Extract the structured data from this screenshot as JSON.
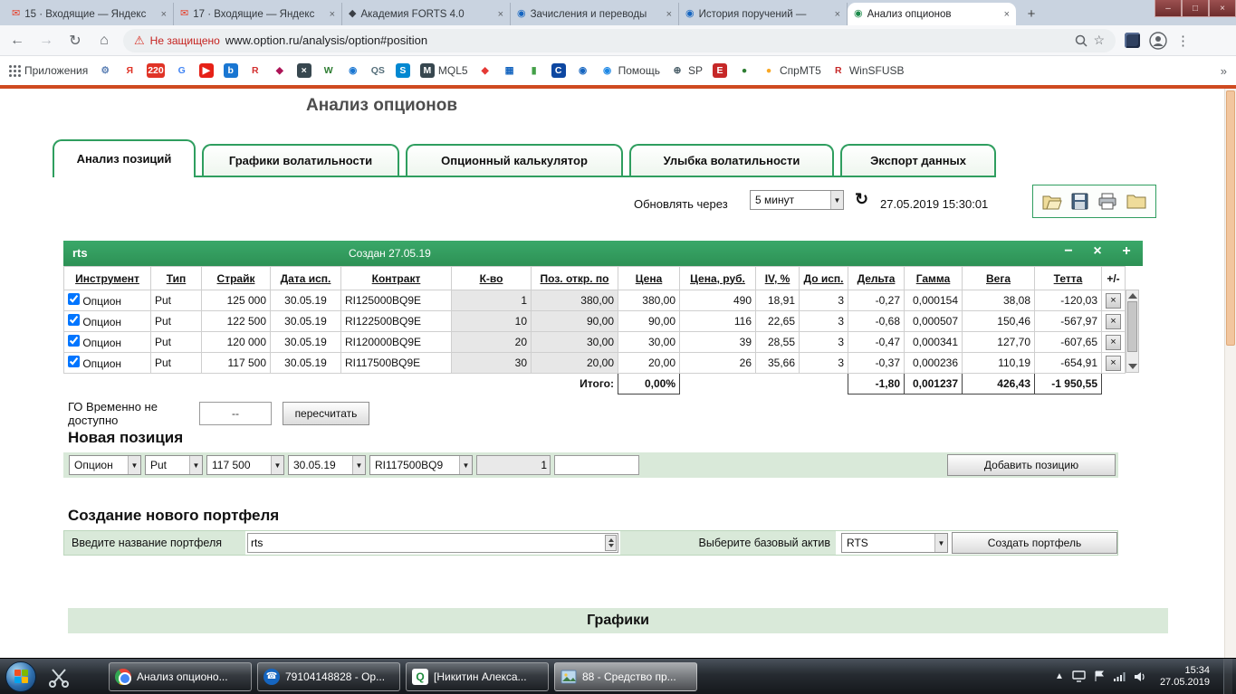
{
  "ui": {
    "arrow": "▼",
    "refresh": "↻",
    "star": "☆",
    "menu": "⋮",
    "overflow": "»",
    "chevron_up": "▲",
    "warning": "⚠",
    "minus": "−",
    "close": "×",
    "plus": "+",
    "tab_close": "×",
    "new_tab": "+",
    "green": "#2f9e5f",
    "light_green": "#d9e9d9",
    "red_line": "#cf4a20"
  },
  "browser": {
    "window_controls": {
      "minimize": "–",
      "maximize": "□",
      "close": "×"
    },
    "tabs": [
      {
        "title": "15 · Входящие — Яндекс",
        "icon_glyph": "✉",
        "icon_color": "#e8402a"
      },
      {
        "title": "17 · Входящие — Яндекс",
        "icon_glyph": "✉",
        "icon_color": "#e8402a"
      },
      {
        "title": "Академия FORTS 4.0",
        "icon_glyph": "◆",
        "icon_color": "#3b3f45"
      },
      {
        "title": "Зачисления и переводы",
        "icon_glyph": "◉",
        "icon_color": "#1565c0"
      },
      {
        "title": "История поручений —",
        "icon_glyph": "◉",
        "icon_color": "#1565c0"
      },
      {
        "title": "Анализ опционов",
        "icon_glyph": "◉",
        "icon_color": "#1b8a4a"
      }
    ],
    "nav": {
      "back": "←",
      "forward": "→",
      "reload": "↻",
      "home": "⌂"
    },
    "address": {
      "security_text": "Не защищено",
      "url": "www.option.ru/analysis/option#position"
    },
    "bookmarks_label": "Приложения",
    "bookmarks": [
      {
        "glyph": "⚙",
        "bg": "transparent",
        "fg": "#5b7fb4",
        "label": ""
      },
      {
        "glyph": "Я",
        "bg": "transparent",
        "fg": "#e03326",
        "label": ""
      },
      {
        "glyph": "220",
        "bg": "#e03326",
        "fg": "#ffffff",
        "label": ""
      },
      {
        "glyph": "G",
        "bg": "transparent",
        "fg": "#4285f4",
        "label": ""
      },
      {
        "glyph": "▶",
        "bg": "#e62117",
        "fg": "#ffffff",
        "label": ""
      },
      {
        "glyph": "b",
        "bg": "#1976d2",
        "fg": "#ffffff",
        "label": ""
      },
      {
        "glyph": "R",
        "bg": "transparent",
        "fg": "#d32f2f",
        "label": ""
      },
      {
        "glyph": "◆",
        "bg": "transparent",
        "fg": "#ad1457",
        "label": ""
      },
      {
        "glyph": "×",
        "bg": "#37474f",
        "fg": "#ffffff",
        "label": ""
      },
      {
        "glyph": "W",
        "bg": "transparent",
        "fg": "#2e7d32",
        "label": ""
      },
      {
        "glyph": "◉",
        "bg": "transparent",
        "fg": "#1976d2",
        "label": ""
      },
      {
        "glyph": "QS",
        "bg": "transparent",
        "fg": "#546e7a",
        "label": ""
      },
      {
        "glyph": "S",
        "bg": "#0288d1",
        "fg": "#ffffff",
        "label": ""
      },
      {
        "glyph": "M",
        "bg": "#37474f",
        "fg": "#ffffff",
        "label": "MQL5"
      },
      {
        "glyph": "◆",
        "bg": "transparent",
        "fg": "#e53935",
        "label": ""
      },
      {
        "glyph": "▦",
        "bg": "transparent",
        "fg": "#1565c0",
        "label": ""
      },
      {
        "glyph": "▮",
        "bg": "transparent",
        "fg": "#43a047",
        "label": ""
      },
      {
        "glyph": "C",
        "bg": "#0d47a1",
        "fg": "#ffffff",
        "label": ""
      },
      {
        "glyph": "◉",
        "bg": "transparent",
        "fg": "#1565c0",
        "label": ""
      },
      {
        "glyph": "◉",
        "bg": "transparent",
        "fg": "#1e88e5",
        "label": "Помощь"
      },
      {
        "glyph": "⊕",
        "bg": "transparent",
        "fg": "#455a64",
        "label": "SP"
      },
      {
        "glyph": "Е",
        "bg": "#c62828",
        "fg": "#ffffff",
        "label": ""
      },
      {
        "glyph": "●",
        "bg": "transparent",
        "fg": "#2e7d32",
        "label": ""
      },
      {
        "glyph": "●",
        "bg": "transparent",
        "fg": "#f9a825",
        "label": "СпрМТ5"
      },
      {
        "glyph": "R",
        "bg": "transparent",
        "fg": "#c62828",
        "label": "WinSFUSB"
      }
    ]
  },
  "page": {
    "title": "Анализ опционов",
    "tabs": [
      {
        "label": "Анализ позиций"
      },
      {
        "label": "Графики волатильности"
      },
      {
        "label": "Опционный калькулятор"
      },
      {
        "label": "Улыбка волатильности"
      },
      {
        "label": "Экспорт данных"
      }
    ],
    "refresh": {
      "label": "Обновлять через",
      "interval": "5 минут",
      "datetime": "27.05.2019 15:30:01"
    },
    "portfolio": {
      "name": "rts",
      "created": "Создан 27.05.19"
    },
    "table": {
      "headers": [
        "Инструмент",
        "Тип",
        "Страйк",
        "Дата исп.",
        "Контракт",
        "К-во",
        "Поз. откр. по",
        "Цена",
        "Цена, руб.",
        "IV, %",
        "До исп.",
        "Дельта",
        "Гамма",
        "Вега",
        "Тетта",
        "+/-"
      ],
      "rows": [
        {
          "instrument": "Опцион",
          "type": "Put",
          "strike": "125 000",
          "exp": "30.05.19",
          "contract": "RI125000BQ9E",
          "qty": "1",
          "pos_open": "380,00",
          "price": "380,00",
          "price_rub": "490",
          "iv": "18,91",
          "days": "3",
          "delta": "-0,27",
          "gamma": "0,000154",
          "vega": "38,08",
          "theta": "-120,03"
        },
        {
          "instrument": "Опцион",
          "type": "Put",
          "strike": "122 500",
          "exp": "30.05.19",
          "contract": "RI122500BQ9E",
          "qty": "10",
          "pos_open": "90,00",
          "price": "90,00",
          "price_rub": "116",
          "iv": "22,65",
          "days": "3",
          "delta": "-0,68",
          "gamma": "0,000507",
          "vega": "150,46",
          "theta": "-567,97"
        },
        {
          "instrument": "Опцион",
          "type": "Put",
          "strike": "120 000",
          "exp": "30.05.19",
          "contract": "RI120000BQ9E",
          "qty": "20",
          "pos_open": "30,00",
          "price": "30,00",
          "price_rub": "39",
          "iv": "28,55",
          "days": "3",
          "delta": "-0,47",
          "gamma": "0,000341",
          "vega": "127,70",
          "theta": "-607,65"
        },
        {
          "instrument": "Опцион",
          "type": "Put",
          "strike": "117 500",
          "exp": "30.05.19",
          "contract": "RI117500BQ9E",
          "qty": "30",
          "pos_open": "20,00",
          "price": "20,00",
          "price_rub": "26",
          "iv": "35,66",
          "days": "3",
          "delta": "-0,37",
          "gamma": "0,000236",
          "vega": "110,19",
          "theta": "-654,91"
        }
      ],
      "totals": {
        "label": "Итого:",
        "pct": "0,00%",
        "delta": "-1,80",
        "gamma": "0,001237",
        "vega": "426,43",
        "theta": "-1 950,55"
      }
    },
    "go": {
      "text": "ГО Временно не доступно",
      "value": "--",
      "button": "пересчитать"
    },
    "new_position": {
      "heading": "Новая позиция",
      "instrument": "Опцион",
      "type": "Put",
      "strike": "117 500",
      "exp": "30.05.19",
      "contract": "RI117500BQ9",
      "qty": "1",
      "button": "Добавить позицию"
    },
    "new_portfolio": {
      "heading": "Создание нового портфеля",
      "name_label": "Введите название портфеля",
      "name_value": "rts",
      "asset_label": "Выберите базовый актив",
      "asset_value": "RTS",
      "button": "Создать портфель"
    },
    "charts_heading": "Графики"
  },
  "taskbar": {
    "buttons": [
      {
        "label": "Анализ опционо..."
      },
      {
        "label": "79104148828 - Op..."
      },
      {
        "label": "[Никитин Алекса..."
      },
      {
        "label": "88 - Средство пр..."
      }
    ],
    "quik_letter": "Q",
    "phone_glyph": "☎",
    "tray": {
      "time": "15:34",
      "date": "27.05.2019"
    }
  }
}
